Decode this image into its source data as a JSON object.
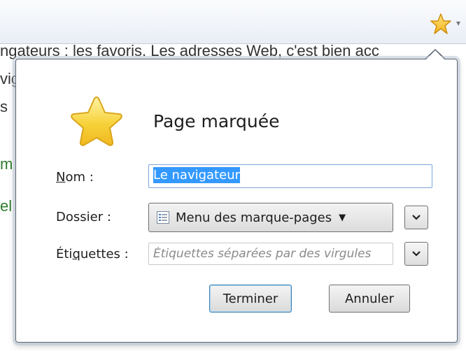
{
  "background_text": [
    "ngateurs : les favoris. Les adresses Web, c'est bien acc",
    "vig",
    "s",
    "m",
    "el"
  ],
  "dialog": {
    "title": "Page marquée",
    "name_label_accesskey": "N",
    "name_label_rest": "om :",
    "name_value": "Le navigateur",
    "folder_label": "Dossier :",
    "folder_value": "Menu des marque-pages",
    "tags_label_pre": "Éti",
    "tags_label_accesskey": "q",
    "tags_label_post": "uettes :",
    "tags_placeholder": "Étiquettes séparées par des virgules",
    "done_button": "Terminer",
    "cancel_button": "Annuler"
  },
  "icons": {
    "toolbar_star": "bookmark-star-icon",
    "dialog_star": "star-icon",
    "folder": "bookmarks-menu-icon",
    "dropdown": "chevron-down-icon"
  },
  "colors": {
    "star_fill": "#f7d23a",
    "star_stroke": "#d9a61c",
    "selection": "#3399ff",
    "primary_border": "#3c7fb1"
  }
}
